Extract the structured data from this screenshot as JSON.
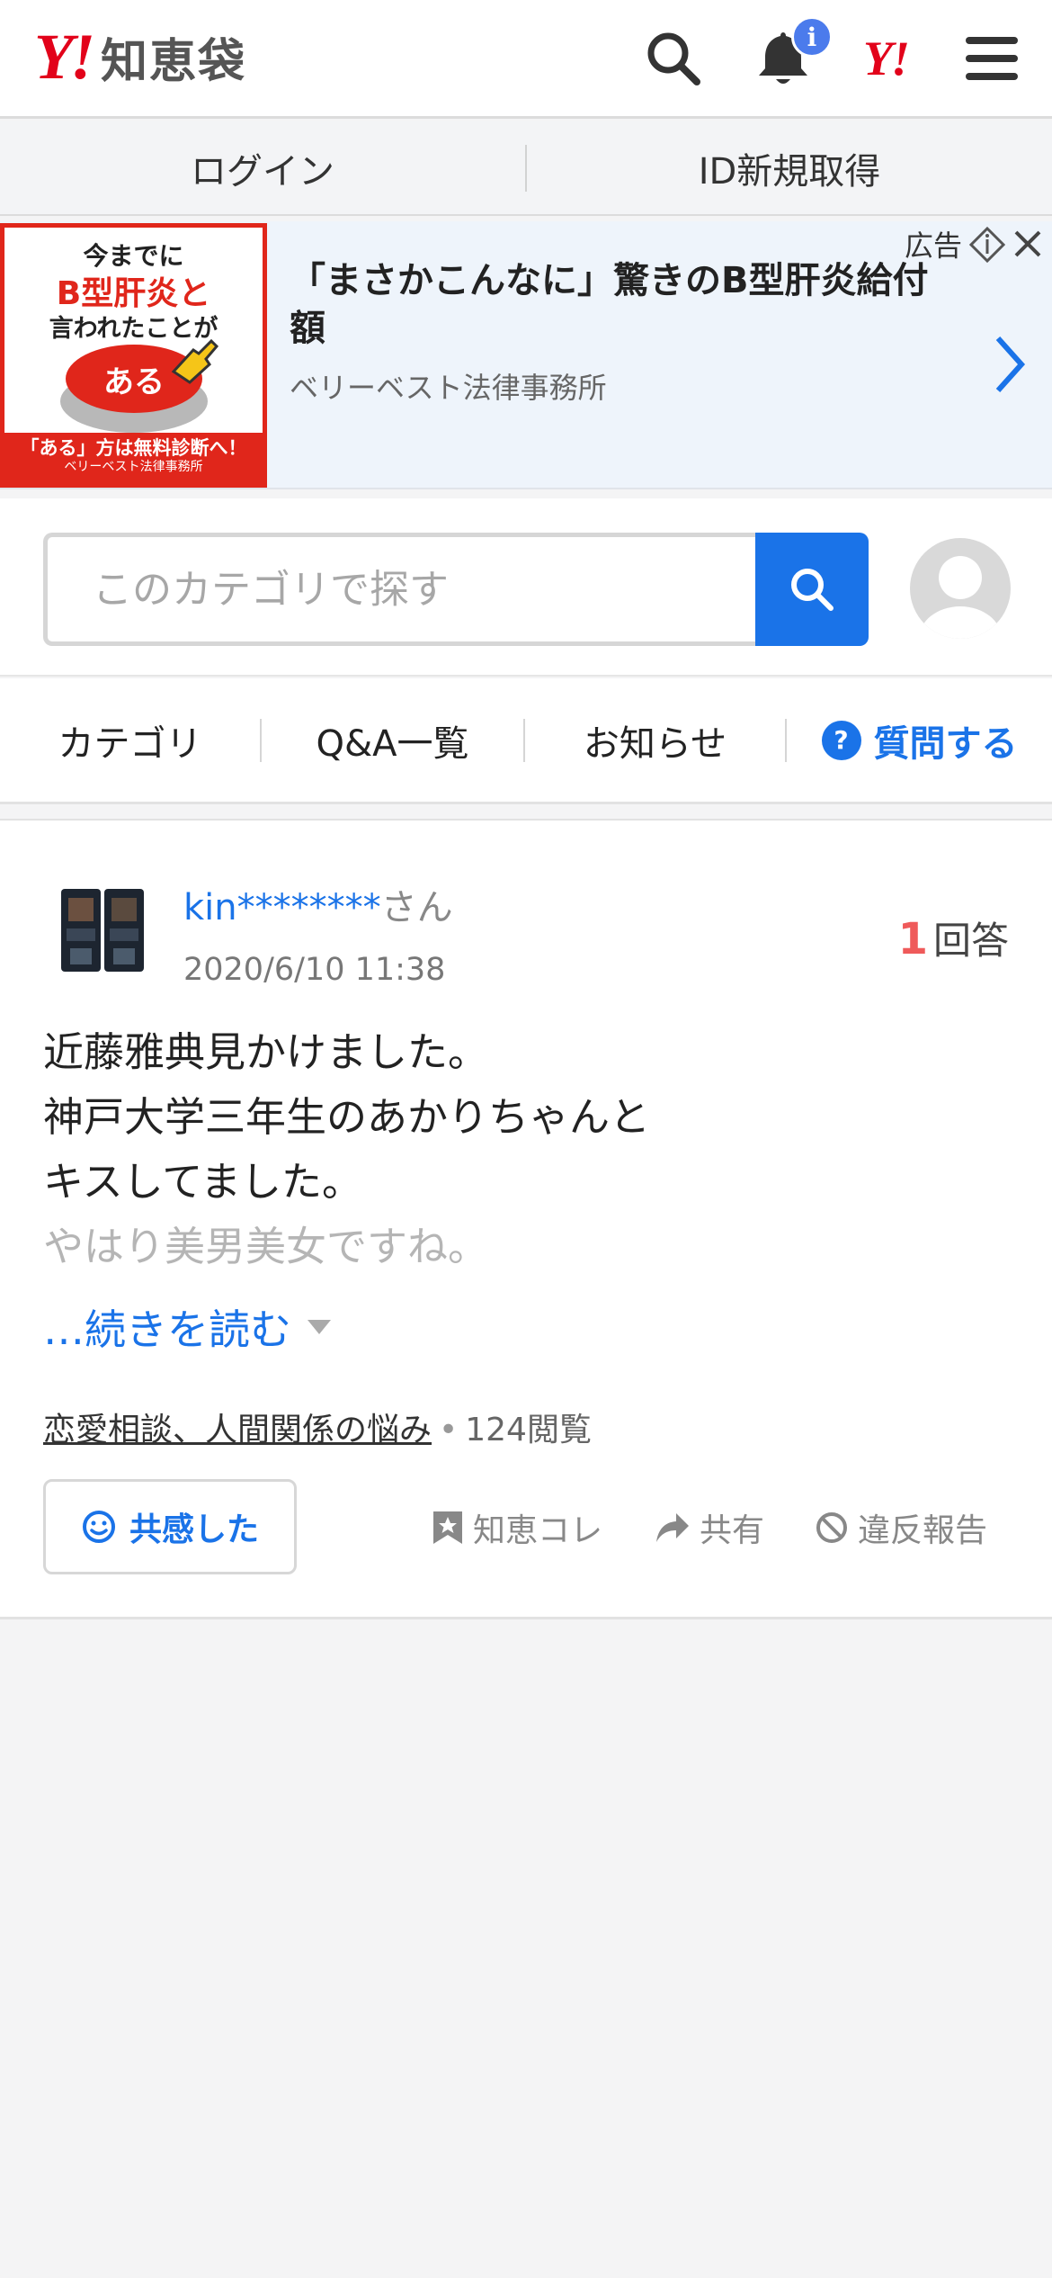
{
  "header": {
    "logo_mark": "Y!",
    "logo_text": "知恵袋",
    "notification_badge": "i",
    "yj_mark": "Y!"
  },
  "loginbar": {
    "login": "ログイン",
    "register": "ID新規取得"
  },
  "ad": {
    "image_text_1": "今までに",
    "image_text_2": "B型肝炎と",
    "image_text_3": "言われたことが",
    "image_button": "ある",
    "image_footer": "「ある」方は無料診断へ！",
    "image_footer_sub": "ベリーベスト法律事務所",
    "title": "「まさかこんなに」驚きのB型肝炎給付額",
    "advertiser": "ベリーベスト法律事務所",
    "label": "広告"
  },
  "search": {
    "placeholder": "このカテゴリで探す"
  },
  "tabs": {
    "category": "カテゴリ",
    "qa_list": "Q&A一覧",
    "notice": "お知らせ",
    "ask": "質問する"
  },
  "question": {
    "username": "kin********",
    "honorific": "さん",
    "date": "2020/6/10 11:38",
    "answer_count": "1",
    "answer_label": "回答",
    "body_line_1": "近藤雅典見かけました。",
    "body_line_2": "神戸大学三年生のあかりちゃんと",
    "body_line_3": "キスしてました。",
    "body_line_4": "やはり美男美女ですね。",
    "read_more": "…続きを読む",
    "category": "恋愛相談、人間関係の悩み",
    "views": "124閲覧",
    "empathy": "共感した",
    "bookmark": "知恵コレ",
    "share": "共有",
    "report": "違反報告"
  },
  "colors": {
    "brand_red": "#e2021a",
    "accent_blue": "#1a73e8",
    "answer_count_red": "#ef5a5a"
  }
}
